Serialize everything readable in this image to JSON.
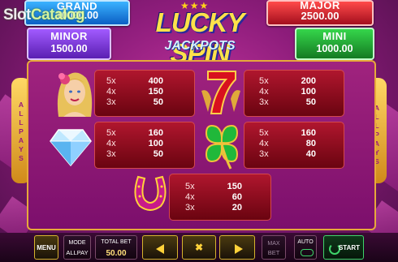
{
  "watermark": {
    "part1": "Slot",
    "part2": "Catalog"
  },
  "logo": {
    "stars": "★★★",
    "title": "LUCKY SPIN",
    "subtitle": "JACKPOTS"
  },
  "jackpots": {
    "grand": {
      "label": "GRAND",
      "value": "10000.00"
    },
    "major": {
      "label": "MAJOR",
      "value": "2500.00"
    },
    "minor": {
      "label": "MINOR",
      "value": "1500.00"
    },
    "mini": {
      "label": "MINI",
      "value": "1000.00"
    }
  },
  "side_label": [
    "A",
    "L",
    "L",
    "P",
    "A",
    "Y",
    "S"
  ],
  "paytable": {
    "lady": [
      {
        "m": "5x",
        "v": "400"
      },
      {
        "m": "4x",
        "v": "150"
      },
      {
        "m": "3x",
        "v": "50"
      }
    ],
    "seven": [
      {
        "m": "5x",
        "v": "200"
      },
      {
        "m": "4x",
        "v": "100"
      },
      {
        "m": "3x",
        "v": "50"
      }
    ],
    "diamond": [
      {
        "m": "5x",
        "v": "160"
      },
      {
        "m": "4x",
        "v": "100"
      },
      {
        "m": "3x",
        "v": "50"
      }
    ],
    "clover": [
      {
        "m": "5x",
        "v": "160"
      },
      {
        "m": "4x",
        "v": "80"
      },
      {
        "m": "3x",
        "v": "40"
      }
    ],
    "horseshoe": [
      {
        "m": "5x",
        "v": "150"
      },
      {
        "m": "4x",
        "v": "60"
      },
      {
        "m": "3x",
        "v": "20"
      }
    ]
  },
  "toolbar": {
    "menu": "MENU",
    "mode_label": "MODE",
    "mode_value": "ALLPAY",
    "total_bet_label": "TOTAL BET",
    "total_bet_value": "50.00",
    "max_bet_1": "MAX",
    "max_bet_2": "BET",
    "auto": "AUTO",
    "start": "START",
    "close_glyph": "✖"
  },
  "colors": {
    "accent_gold": "#e7a93a",
    "start_green": "#3ed46a"
  }
}
